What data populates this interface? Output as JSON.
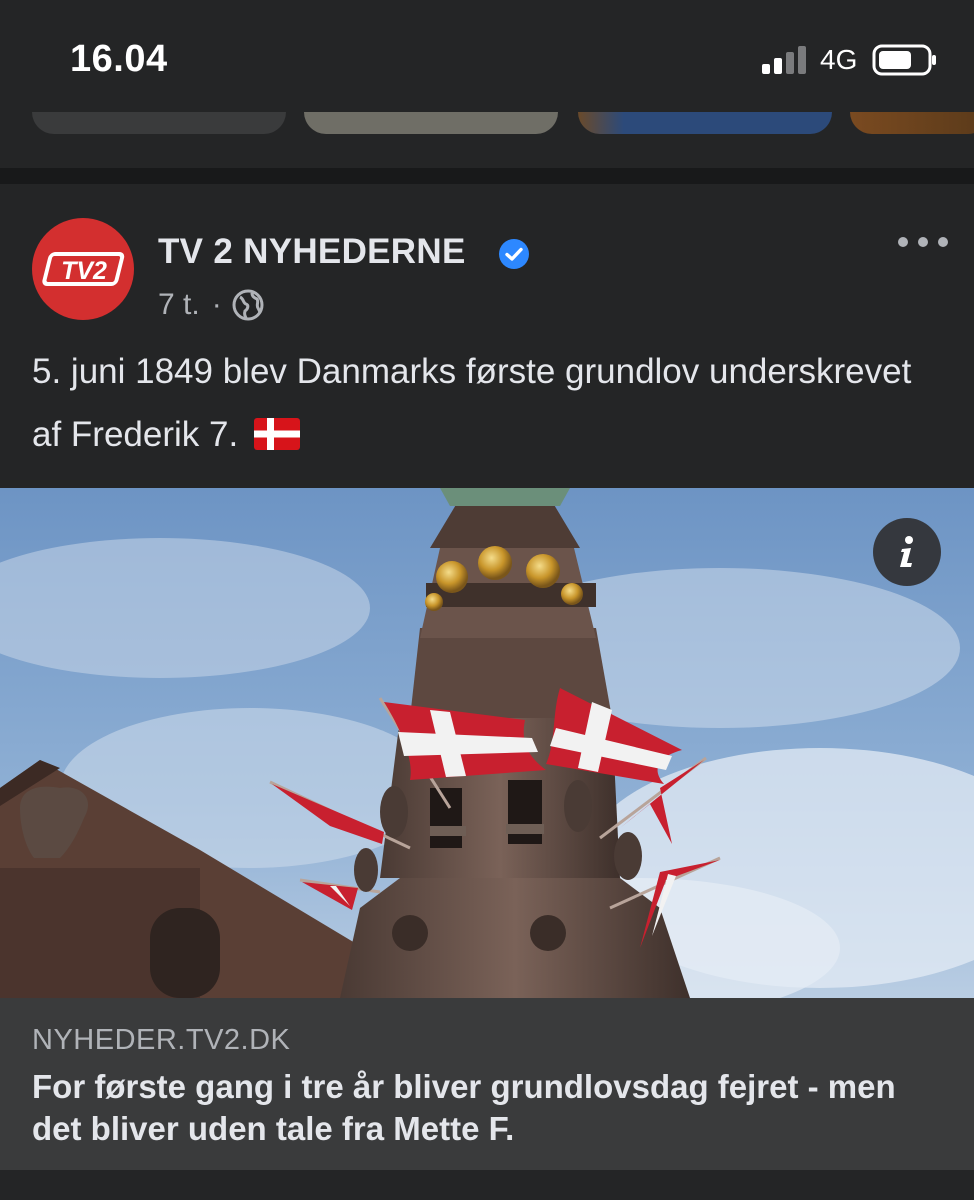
{
  "status_bar": {
    "time": "16.04",
    "network": "4G",
    "icons": [
      "signal-bars-icon",
      "battery-icon"
    ]
  },
  "post": {
    "page_name": "TV 2 NYHEDERNE",
    "avatar_logo_text": "TV2",
    "brand_color": "#d32f2f",
    "verified_color": "#2d88ff",
    "time_ago": "7 t.",
    "separator": "·",
    "audience_icon": "globe-icon",
    "text": "5. juni 1849 blev Danmarks første grundlov underskrevet af Frederik 7.",
    "emoji": "denmark-flag-icon",
    "link": {
      "domain": "NYHEDER.TV2.DK",
      "title": "For første gang i tre år bliver grundlovsdag fejret - men det bliver uden tale fra Mette F."
    }
  }
}
